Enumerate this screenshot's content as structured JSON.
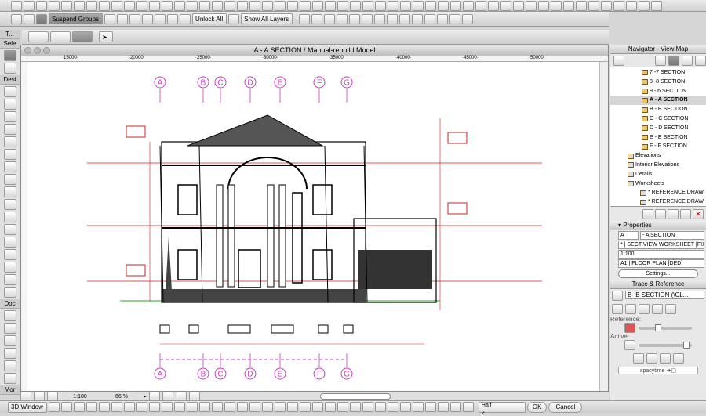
{
  "toolbar2": {
    "suspend_groups": "Suspend Groups",
    "unlock_all": "Unlock All",
    "show_all_layers": "Show All Layers"
  },
  "toolbox": {
    "title": "T...",
    "select": "Sele",
    "design": "Desi",
    "document": "Doc",
    "more": "Mor"
  },
  "window": {
    "title": "A - A SECTION / Manual-rebuild Model"
  },
  "ruler": [
    "15000",
    "20000",
    "25000",
    "30000",
    "35000",
    "40000",
    "45000",
    "50000"
  ],
  "gridlines": [
    "A",
    "B",
    "C",
    "D",
    "E",
    "F",
    "G"
  ],
  "navigator": {
    "title": "Navigator - View Map",
    "items": [
      {
        "label": "7 -7 SECTION",
        "type": "section"
      },
      {
        "label": "8 -8 SECTION",
        "type": "section"
      },
      {
        "label": "9 - 6 SECTION",
        "type": "section"
      },
      {
        "label": "A - A SECTION",
        "type": "section",
        "selected": true
      },
      {
        "label": "B - B SECTION",
        "type": "section"
      },
      {
        "label": "C - C SECTION",
        "type": "section"
      },
      {
        "label": "D - D SECTION",
        "type": "section"
      },
      {
        "label": "E - E SECTION",
        "type": "section"
      },
      {
        "label": "F - F SECTION",
        "type": "section"
      },
      {
        "label": "Elevations",
        "type": "folder"
      },
      {
        "label": "Interior Elevations",
        "type": "folder"
      },
      {
        "label": "Details",
        "type": "folder"
      },
      {
        "label": "Worksheets",
        "type": "folder"
      },
      {
        "label": "* REFERENCE DRAW",
        "type": "sheet"
      },
      {
        "label": "* REFERENCE DRAW",
        "type": "sheet"
      },
      {
        "label": "* REFERENCE DRAW",
        "type": "sheet"
      }
    ]
  },
  "properties": {
    "title": "Properties",
    "id": "A",
    "name": "- A SECTION",
    "layer": "* | SECT VIEW-WORKSHEET [FIX]",
    "scale": "1:100",
    "layout": "A1 | FLOOR PLAN [DED]",
    "settings": "Settings..."
  },
  "trace": {
    "title": "Trace & Reference",
    "source": "B- B SECTION (\\CL...",
    "reference_label": "Reference:",
    "active_label": "Active:",
    "reference_level": 0.35,
    "active_level": 0.95
  },
  "user": "spacytime",
  "status": {
    "scale": "1:100",
    "zoom": "66 %"
  },
  "bottom": {
    "window_3d": "3D Window",
    "pen": "Half",
    "pen_num": "2",
    "ok": "OK",
    "cancel": "Cancel"
  },
  "colors": {
    "grid": "#c040c0",
    "dim": "#cc2222",
    "ground": "#22aa22"
  }
}
